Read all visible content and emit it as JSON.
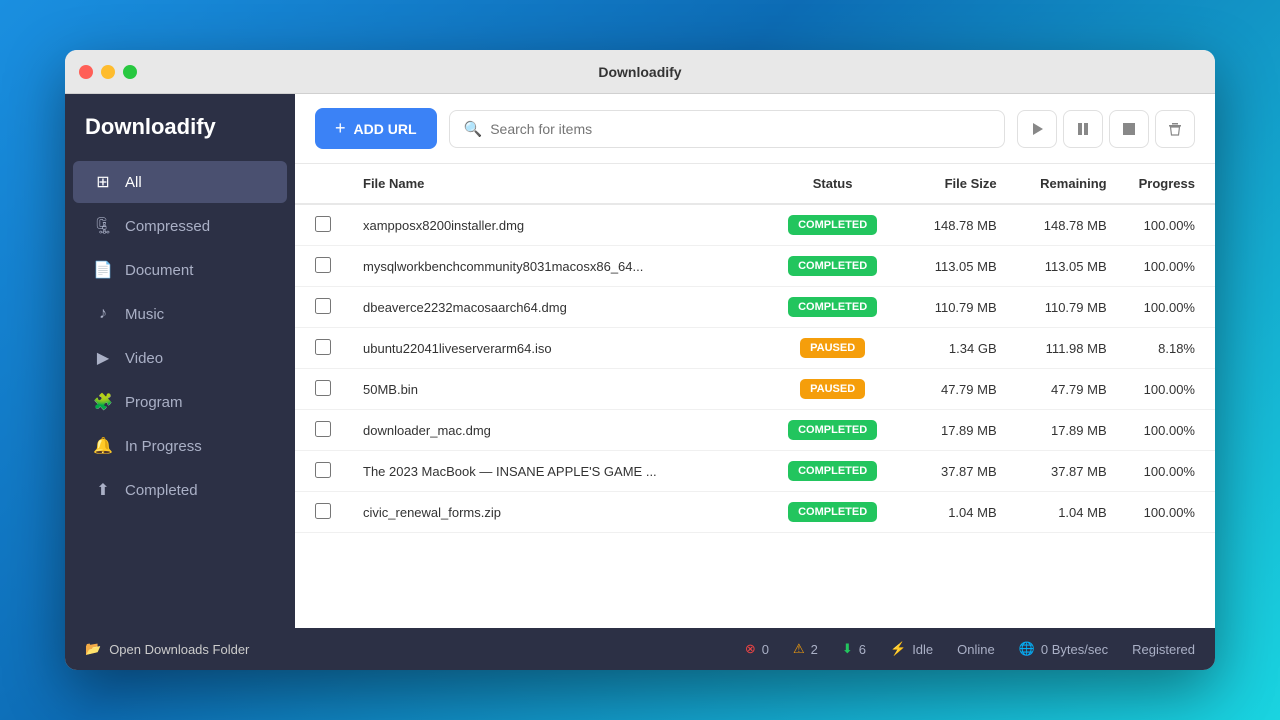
{
  "app": {
    "title": "Downloadify",
    "sidebar_title": "Downloadify"
  },
  "titlebar": {
    "title": "Downloadify"
  },
  "sidebar": {
    "items": [
      {
        "id": "all",
        "label": "All",
        "icon": "⊞",
        "active": true
      },
      {
        "id": "compressed",
        "label": "Compressed",
        "icon": "🗜"
      },
      {
        "id": "document",
        "label": "Document",
        "icon": "📄"
      },
      {
        "id": "music",
        "label": "Music",
        "icon": "♪"
      },
      {
        "id": "video",
        "label": "Video",
        "icon": "▶"
      },
      {
        "id": "program",
        "label": "Program",
        "icon": "🧩"
      },
      {
        "id": "in-progress",
        "label": "In Progress",
        "icon": "🔔"
      },
      {
        "id": "completed",
        "label": "Completed",
        "icon": "⬆"
      }
    ]
  },
  "toolbar": {
    "add_url_label": "ADD URL",
    "search_placeholder": "Search for items"
  },
  "table": {
    "columns": [
      "",
      "File Name",
      "Status",
      "File Size",
      "Remaining",
      "Progress"
    ],
    "rows": [
      {
        "filename": "xampposx8200installer.dmg",
        "status": "COMPLETED",
        "status_type": "completed",
        "file_size": "148.78 MB",
        "remaining": "148.78 MB",
        "progress": "100.00%"
      },
      {
        "filename": "mysqlworkbenchcommunity8031macosx86_64...",
        "status": "COMPLETED",
        "status_type": "completed",
        "file_size": "113.05 MB",
        "remaining": "113.05 MB",
        "progress": "100.00%"
      },
      {
        "filename": "dbeaverce2232macosaarch64.dmg",
        "status": "COMPLETED",
        "status_type": "completed",
        "file_size": "110.79 MB",
        "remaining": "110.79 MB",
        "progress": "100.00%"
      },
      {
        "filename": "ubuntu22041liveserverarm64.iso",
        "status": "PAUSED",
        "status_type": "paused",
        "file_size": "1.34 GB",
        "remaining": "111.98 MB",
        "progress": "8.18%"
      },
      {
        "filename": "50MB.bin",
        "status": "PAUSED",
        "status_type": "paused",
        "file_size": "47.79 MB",
        "remaining": "47.79 MB",
        "progress": "100.00%"
      },
      {
        "filename": "downloader_mac.dmg",
        "status": "COMPLETED",
        "status_type": "completed",
        "file_size": "17.89 MB",
        "remaining": "17.89 MB",
        "progress": "100.00%"
      },
      {
        "filename": "The 2023 MacBook — INSANE APPLE'S GAME ...",
        "status": "COMPLETED",
        "status_type": "completed",
        "file_size": "37.87 MB",
        "remaining": "37.87 MB",
        "progress": "100.00%"
      },
      {
        "filename": "civic_renewal_forms.zip",
        "status": "COMPLETED",
        "status_type": "completed",
        "file_size": "1.04 MB",
        "remaining": "1.04 MB",
        "progress": "100.00%"
      }
    ]
  },
  "statusbar": {
    "open_downloads_label": "Open Downloads Folder",
    "errors": "0",
    "warnings": "2",
    "downloads": "6",
    "status": "Idle",
    "connection": "Online",
    "speed": "0 Bytes/sec",
    "registration": "Registered"
  }
}
